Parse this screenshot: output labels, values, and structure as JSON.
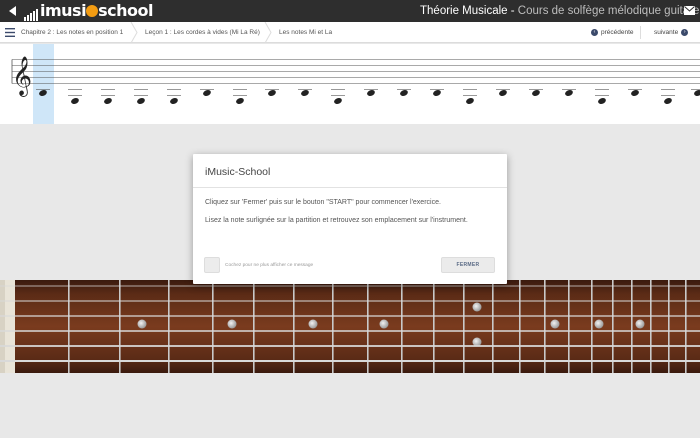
{
  "topbar": {
    "back_icon": "back-arrow-icon",
    "logo_text_pre": "imusi",
    "logo_text_post": "school",
    "brand_color": "#f39c12",
    "title_main": "Théorie Musicale -",
    "title_sub": " Cours de solfège mélodique guitare",
    "mail_icon": "mail-icon"
  },
  "breadcrumb": {
    "items": [
      "Chapitre 2 : Les notes en position 1",
      "Leçon 1 : Les cordes à vides (Mi La Ré)",
      "Les notes Mi et La"
    ],
    "prev_label": "précédente",
    "next_label": "suivante"
  },
  "staff": {
    "clef": "treble",
    "highlighted_note_index": 0,
    "highlight_color": "#cfe6f8"
  },
  "modal": {
    "title": "iMusic-School",
    "text1": "Cliquez sur 'Fermer' puis sur le bouton \"START\" pour commencer l'exercice.",
    "text2": "Lisez la note surlignée sur la partition et retrouvez son emplacement sur l'instrument.",
    "checkbox_label": "Cochez pour ne plus afficher ce message",
    "close_label": "FERMER"
  }
}
